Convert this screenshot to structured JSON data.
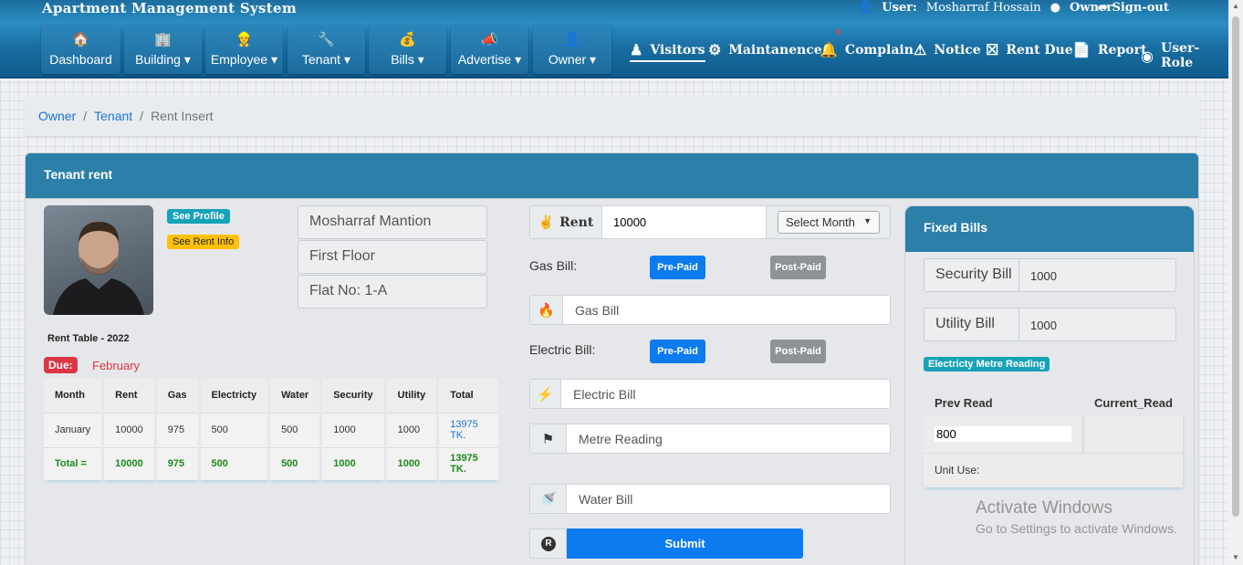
{
  "app": {
    "title": "Apartment Management System"
  },
  "user": {
    "label": "User:",
    "name": "Mosharraf Hossain",
    "role": "Owner",
    "signout": "Sign-out"
  },
  "nav": {
    "dashboard": "Dashboard",
    "building": "Building",
    "employee": "Employee",
    "tenant": "Tenant",
    "bills": "Bills",
    "advertise": "Advertise",
    "owner": "Owner",
    "visitors": "Visitors",
    "maintanence": "Maintanence",
    "complain": "Complain",
    "complain_badge": "0",
    "notice": "Notice",
    "rent_due": "Rent Due",
    "report": "Report",
    "user_role": "User-Role"
  },
  "breadcrumb": {
    "items": [
      "Owner",
      "Tenant"
    ],
    "current": "Rent Insert"
  },
  "card": {
    "title": "Tenant rent"
  },
  "profile": {
    "see_profile": "See Profile",
    "see_rent_info": "See Rent Info",
    "building": "Mosharraf Mantion",
    "floor": "First Floor",
    "flat": "Flat No: 1-A"
  },
  "rent_table": {
    "title": "Rent Table - 2022",
    "due_label": "Due:",
    "due_month": "February",
    "headers": [
      "Month",
      "Rent",
      "Gas",
      "Electricty",
      "Water",
      "Security",
      "Utility",
      "Total"
    ],
    "row": [
      "January",
      "10000",
      "975",
      "500",
      "500",
      "1000",
      "1000",
      "13975 TK."
    ],
    "total": [
      "Total =",
      "10000",
      "975",
      "500",
      "500",
      "1000",
      "1000",
      "13975 TK."
    ]
  },
  "form": {
    "rent_label": "Rent",
    "rent_value": "10000",
    "month_select": "Select Month",
    "gas_label": "Gas Bill:",
    "pre_paid": "Pre-Paid",
    "post_paid": "Post-Paid",
    "gas_placeholder": "Gas Bill",
    "electric_label": "Electric Bill:",
    "electric_placeholder": "Electric Bill",
    "meter_placeholder": "Metre Reading",
    "water_placeholder": "Water Bill",
    "submit": "Submit"
  },
  "fixed": {
    "title": "Fixed Bills",
    "security_label": "Security Bill",
    "security_value": "1000",
    "utility_label": "Utility Bill",
    "utility_value": "1000",
    "meter_badge": "Electricty Metre Reading",
    "prev_read": "Prev Read",
    "current_read": "Current_Read",
    "prev_value": "800",
    "unit_use": "Unit Use:"
  },
  "watermark": {
    "line1": "Activate Windows",
    "line2": "Go to Settings to activate Windows."
  },
  "colors": {
    "nav": "#1f75a8",
    "primary": "#0d7bf0",
    "secondary": "#8e9398",
    "info": "#17a2b8",
    "warning": "#ffc107",
    "danger": "#dc3545"
  }
}
